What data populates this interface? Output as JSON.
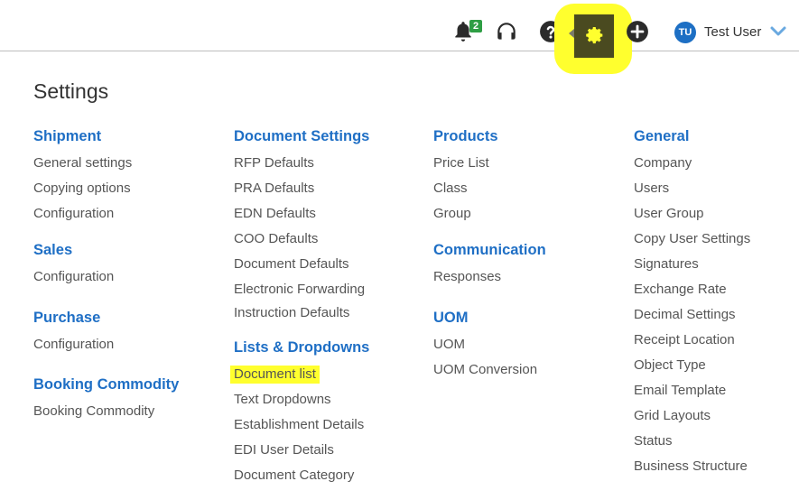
{
  "header": {
    "notification_count": "2",
    "user_initials": "TU",
    "user_name": "Test User"
  },
  "page_title": "Settings",
  "columns": [
    {
      "sections": [
        {
          "title": "Shipment",
          "items": [
            "General settings",
            "Copying options",
            "Configuration"
          ]
        },
        {
          "title": "Sales",
          "items": [
            "Configuration"
          ]
        },
        {
          "title": "Purchase",
          "items": [
            "Configuration"
          ]
        },
        {
          "title": "Booking Commodity",
          "items": [
            "Booking Commodity"
          ]
        }
      ]
    },
    {
      "sections": [
        {
          "title": "Document Settings",
          "items": [
            "RFP Defaults",
            "PRA Defaults",
            "EDN Defaults",
            "COO Defaults",
            "Document Defaults",
            "Electronic Forwarding",
            "Instruction Defaults"
          ]
        },
        {
          "title": "Lists & Dropdowns",
          "items": [
            "Document list",
            "Text Dropdowns",
            "Establishment Details",
            "EDI User Details",
            "Document Category"
          ]
        }
      ]
    },
    {
      "sections": [
        {
          "title": "Products",
          "items": [
            "Price List",
            "Class",
            "Group"
          ]
        },
        {
          "title": "Communication",
          "items": [
            "Responses"
          ]
        },
        {
          "title": "UOM",
          "items": [
            "UOM",
            "UOM Conversion"
          ]
        }
      ]
    },
    {
      "sections": [
        {
          "title": "General",
          "items": [
            "Company",
            "Users",
            "User Group",
            "Copy User Settings",
            "Signatures",
            "Exchange Rate",
            "Decimal Settings",
            "Receipt Location",
            "Object Type",
            "Email Template",
            "Grid Layouts",
            "Status",
            "Business Structure"
          ]
        }
      ]
    }
  ],
  "highlights": {
    "highlight_color": "#ffff2e",
    "highlighted_icon": "gear-icon",
    "highlighted_item": "Document list"
  },
  "icons": [
    "bell-icon",
    "headset-icon",
    "help-icon",
    "gear-icon",
    "plus-icon",
    "chevron-down-icon"
  ],
  "colors": {
    "link_blue": "#1f6fc5",
    "badge_green": "#2e9e44",
    "avatar_blue": "#1d6fc4"
  }
}
